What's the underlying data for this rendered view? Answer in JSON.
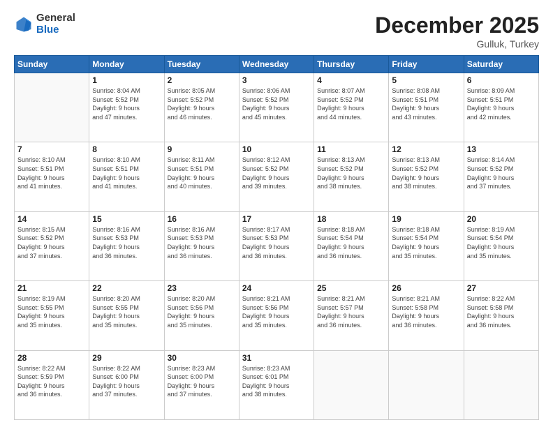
{
  "header": {
    "logo_general": "General",
    "logo_blue": "Blue",
    "title": "December 2025",
    "location": "Gulluk, Turkey"
  },
  "days_of_week": [
    "Sunday",
    "Monday",
    "Tuesday",
    "Wednesday",
    "Thursday",
    "Friday",
    "Saturday"
  ],
  "weeks": [
    [
      {
        "day": "",
        "info": ""
      },
      {
        "day": "1",
        "info": "Sunrise: 8:04 AM\nSunset: 5:52 PM\nDaylight: 9 hours\nand 47 minutes."
      },
      {
        "day": "2",
        "info": "Sunrise: 8:05 AM\nSunset: 5:52 PM\nDaylight: 9 hours\nand 46 minutes."
      },
      {
        "day": "3",
        "info": "Sunrise: 8:06 AM\nSunset: 5:52 PM\nDaylight: 9 hours\nand 45 minutes."
      },
      {
        "day": "4",
        "info": "Sunrise: 8:07 AM\nSunset: 5:52 PM\nDaylight: 9 hours\nand 44 minutes."
      },
      {
        "day": "5",
        "info": "Sunrise: 8:08 AM\nSunset: 5:51 PM\nDaylight: 9 hours\nand 43 minutes."
      },
      {
        "day": "6",
        "info": "Sunrise: 8:09 AM\nSunset: 5:51 PM\nDaylight: 9 hours\nand 42 minutes."
      }
    ],
    [
      {
        "day": "7",
        "info": "Sunrise: 8:10 AM\nSunset: 5:51 PM\nDaylight: 9 hours\nand 41 minutes."
      },
      {
        "day": "8",
        "info": "Sunrise: 8:10 AM\nSunset: 5:51 PM\nDaylight: 9 hours\nand 41 minutes."
      },
      {
        "day": "9",
        "info": "Sunrise: 8:11 AM\nSunset: 5:51 PM\nDaylight: 9 hours\nand 40 minutes."
      },
      {
        "day": "10",
        "info": "Sunrise: 8:12 AM\nSunset: 5:52 PM\nDaylight: 9 hours\nand 39 minutes."
      },
      {
        "day": "11",
        "info": "Sunrise: 8:13 AM\nSunset: 5:52 PM\nDaylight: 9 hours\nand 38 minutes."
      },
      {
        "day": "12",
        "info": "Sunrise: 8:13 AM\nSunset: 5:52 PM\nDaylight: 9 hours\nand 38 minutes."
      },
      {
        "day": "13",
        "info": "Sunrise: 8:14 AM\nSunset: 5:52 PM\nDaylight: 9 hours\nand 37 minutes."
      }
    ],
    [
      {
        "day": "14",
        "info": "Sunrise: 8:15 AM\nSunset: 5:52 PM\nDaylight: 9 hours\nand 37 minutes."
      },
      {
        "day": "15",
        "info": "Sunrise: 8:16 AM\nSunset: 5:53 PM\nDaylight: 9 hours\nand 36 minutes."
      },
      {
        "day": "16",
        "info": "Sunrise: 8:16 AM\nSunset: 5:53 PM\nDaylight: 9 hours\nand 36 minutes."
      },
      {
        "day": "17",
        "info": "Sunrise: 8:17 AM\nSunset: 5:53 PM\nDaylight: 9 hours\nand 36 minutes."
      },
      {
        "day": "18",
        "info": "Sunrise: 8:18 AM\nSunset: 5:54 PM\nDaylight: 9 hours\nand 36 minutes."
      },
      {
        "day": "19",
        "info": "Sunrise: 8:18 AM\nSunset: 5:54 PM\nDaylight: 9 hours\nand 35 minutes."
      },
      {
        "day": "20",
        "info": "Sunrise: 8:19 AM\nSunset: 5:54 PM\nDaylight: 9 hours\nand 35 minutes."
      }
    ],
    [
      {
        "day": "21",
        "info": "Sunrise: 8:19 AM\nSunset: 5:55 PM\nDaylight: 9 hours\nand 35 minutes."
      },
      {
        "day": "22",
        "info": "Sunrise: 8:20 AM\nSunset: 5:55 PM\nDaylight: 9 hours\nand 35 minutes."
      },
      {
        "day": "23",
        "info": "Sunrise: 8:20 AM\nSunset: 5:56 PM\nDaylight: 9 hours\nand 35 minutes."
      },
      {
        "day": "24",
        "info": "Sunrise: 8:21 AM\nSunset: 5:56 PM\nDaylight: 9 hours\nand 35 minutes."
      },
      {
        "day": "25",
        "info": "Sunrise: 8:21 AM\nSunset: 5:57 PM\nDaylight: 9 hours\nand 36 minutes."
      },
      {
        "day": "26",
        "info": "Sunrise: 8:21 AM\nSunset: 5:58 PM\nDaylight: 9 hours\nand 36 minutes."
      },
      {
        "day": "27",
        "info": "Sunrise: 8:22 AM\nSunset: 5:58 PM\nDaylight: 9 hours\nand 36 minutes."
      }
    ],
    [
      {
        "day": "28",
        "info": "Sunrise: 8:22 AM\nSunset: 5:59 PM\nDaylight: 9 hours\nand 36 minutes."
      },
      {
        "day": "29",
        "info": "Sunrise: 8:22 AM\nSunset: 6:00 PM\nDaylight: 9 hours\nand 37 minutes."
      },
      {
        "day": "30",
        "info": "Sunrise: 8:23 AM\nSunset: 6:00 PM\nDaylight: 9 hours\nand 37 minutes."
      },
      {
        "day": "31",
        "info": "Sunrise: 8:23 AM\nSunset: 6:01 PM\nDaylight: 9 hours\nand 38 minutes."
      },
      {
        "day": "",
        "info": ""
      },
      {
        "day": "",
        "info": ""
      },
      {
        "day": "",
        "info": ""
      }
    ]
  ]
}
